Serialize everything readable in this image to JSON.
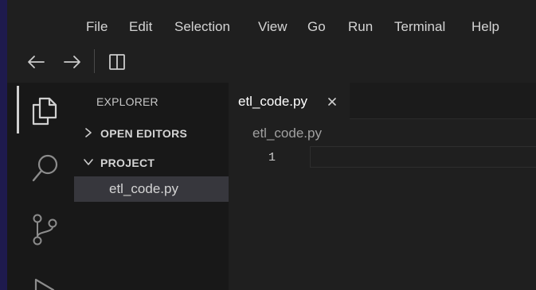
{
  "menu": {
    "items": [
      "File",
      "Edit",
      "Selection",
      "View",
      "Go",
      "Run",
      "Terminal",
      "Help"
    ]
  },
  "toolbar": {
    "back_icon": "arrow-left-icon",
    "forward_icon": "arrow-right-icon",
    "layout_icon": "split-editor-icon"
  },
  "activity_bar": {
    "icons": [
      "explorer-icon",
      "search-icon",
      "source-control-icon",
      "run-debug-icon"
    ],
    "active": "explorer-icon"
  },
  "sidebar": {
    "title": "EXPLORER",
    "open_editors": "OPEN EDITORS",
    "project": "PROJECT",
    "files": [
      "etl_code.py"
    ]
  },
  "editor": {
    "tab_label": "etl_code.py",
    "breadcrumb": "etl_code.py",
    "line_numbers": [
      "1"
    ]
  },
  "colors": {
    "stripe": "#1e1a4d",
    "chrome": "#1f1f1f",
    "sidebar": "#181818",
    "selected_file": "#37373d"
  }
}
